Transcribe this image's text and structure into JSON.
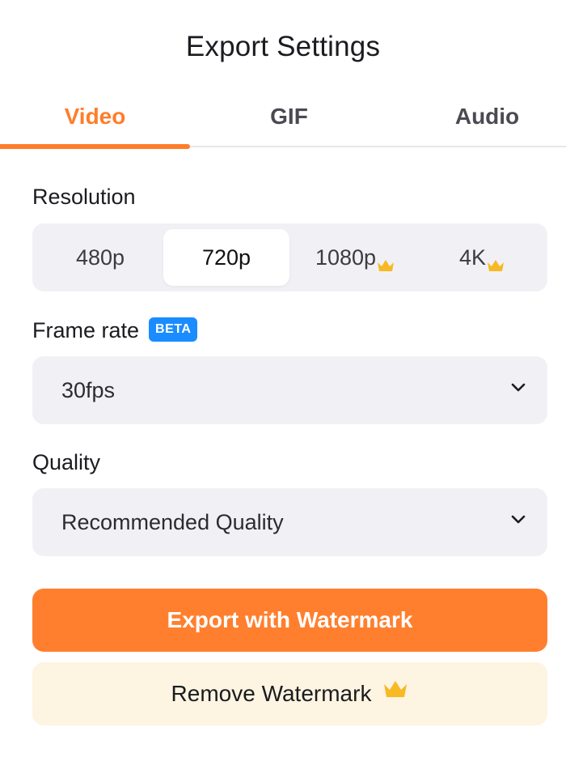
{
  "header": {
    "title": "Export Settings"
  },
  "tabs": [
    {
      "label": "Video",
      "active": true
    },
    {
      "label": "GIF",
      "active": false
    },
    {
      "label": "Audio",
      "active": false
    }
  ],
  "resolution": {
    "label": "Resolution",
    "options": [
      {
        "label": "480p",
        "premium": false
      },
      {
        "label": "720p",
        "premium": false,
        "selected": true
      },
      {
        "label": "1080p",
        "premium": true
      },
      {
        "label": "4K",
        "premium": true
      }
    ]
  },
  "frame_rate": {
    "label": "Frame rate",
    "badge": "BETA",
    "value": "30fps"
  },
  "quality": {
    "label": "Quality",
    "value": "Recommended Quality"
  },
  "actions": {
    "export_label": "Export with Watermark",
    "remove_label": "Remove Watermark"
  },
  "colors": {
    "accent": "#ff7d2a",
    "beta_badge": "#1a8cff",
    "crown": "#f7b924",
    "field_bg": "#f1f1f5",
    "remove_bg": "#fdf4e1"
  },
  "icons": {
    "premium": "crown-icon",
    "dropdown": "chevron-down-icon"
  }
}
